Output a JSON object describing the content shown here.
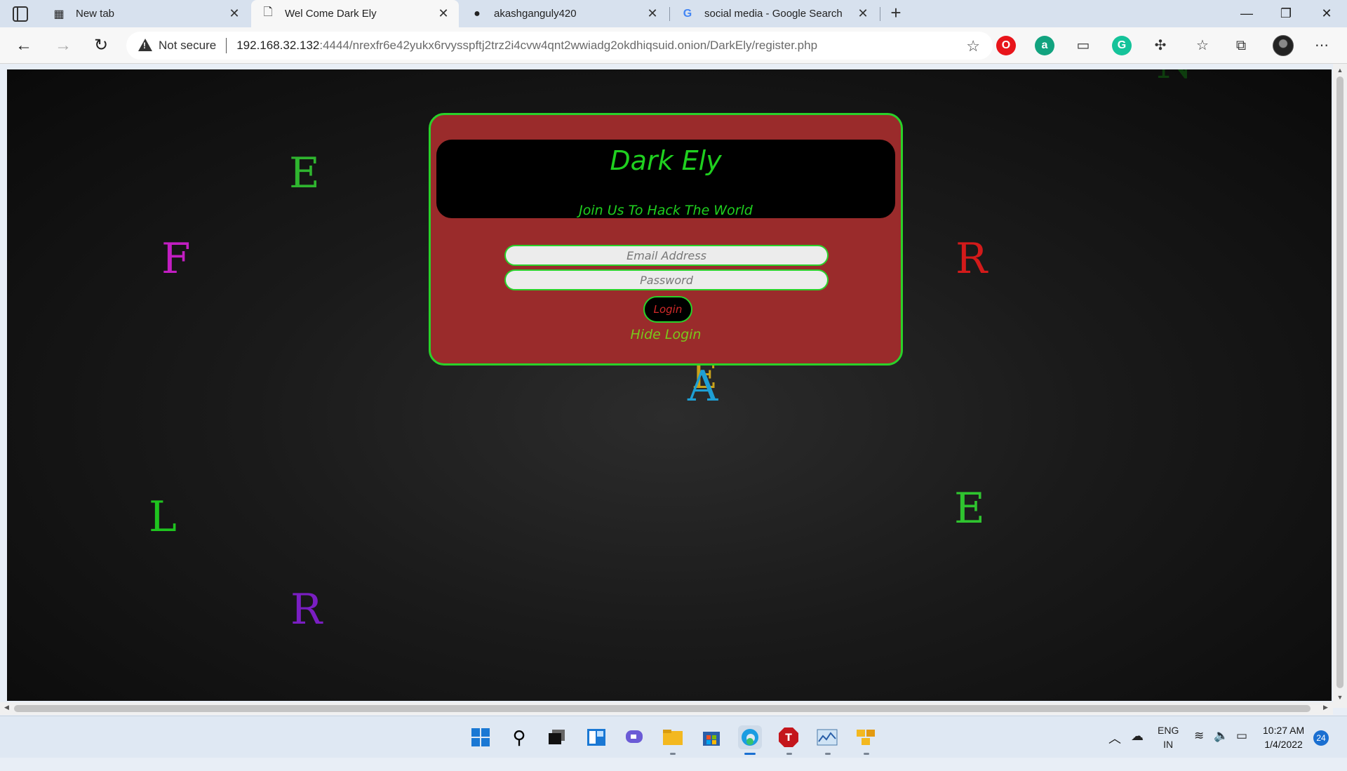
{
  "tabs": [
    {
      "label": "New tab",
      "icon": "newtab-icon"
    },
    {
      "label": "Wel Come Dark Ely",
      "icon": "page-icon",
      "active": true
    },
    {
      "label": "akashganguly420",
      "icon": "github-icon"
    },
    {
      "label": "social media - Google Search",
      "icon": "google-icon"
    }
  ],
  "address": {
    "security_label": "Not secure",
    "url_host": "192.168.32.132",
    "url_rest": ":4444/nrexfr6e42yukx6rvysspftj2trz2i4cvw4qnt2wwiadg2okdhiqsuid.onion/DarkEly/register.php"
  },
  "page": {
    "title": "Dark Ely",
    "subtitle": "Join Us To Hack The World",
    "email_placeholder": "Email Address",
    "password_placeholder": "Password",
    "login_label": "Login",
    "hide_login_label": "Hide Login",
    "letters": [
      {
        "char": "E",
        "color": "#2fb52f"
      },
      {
        "char": "F",
        "color": "#c21ec2"
      },
      {
        "char": "R",
        "color": "#d31a1a"
      },
      {
        "char": "E",
        "color": "#c9a21a"
      },
      {
        "char": "A",
        "color": "#1e9fd4"
      },
      {
        "char": "L",
        "color": "#1fc41f"
      },
      {
        "char": "E",
        "color": "#2fc42f"
      },
      {
        "char": "R",
        "color": "#7a1ec2"
      },
      {
        "char": "N",
        "color": "#0e3d0e"
      }
    ]
  },
  "taskbar": {
    "lang_top": "ENG",
    "lang_bottom": "IN",
    "time": "10:27 AM",
    "date": "1/4/2022",
    "notification_count": "24"
  },
  "colors": {
    "card_bg": "#9a2b2b",
    "accent_green": "#2ad12a",
    "login_text": "#d42a2a"
  }
}
